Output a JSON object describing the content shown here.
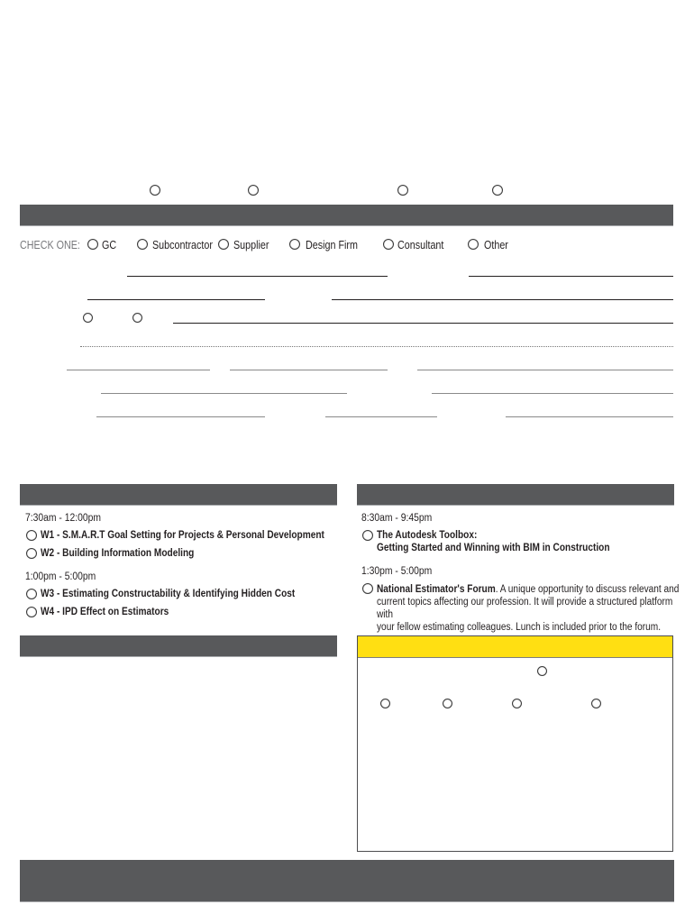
{
  "colors": {
    "header_bar": "#58595b",
    "highlight_header": "#ffdf12",
    "text": "#231f20",
    "muted_text": "#77787b"
  },
  "top_radios": [
    {
      "name": "top-option-1",
      "selected": false
    },
    {
      "name": "top-option-2",
      "selected": false
    },
    {
      "name": "top-option-3",
      "selected": false
    },
    {
      "name": "top-option-4",
      "selected": false
    }
  ],
  "company_type": {
    "label": "CHECK ONE:",
    "options": [
      {
        "label": "GC",
        "selected": false
      },
      {
        "label": "Subcontractor",
        "selected": false
      },
      {
        "label": "Supplier",
        "selected": false
      },
      {
        "label": "Design Firm",
        "selected": false
      },
      {
        "label": "Consultant",
        "selected": false
      },
      {
        "label": "Other",
        "selected": false
      }
    ]
  },
  "inline_radios": [
    {
      "name": "inline-option-1",
      "selected": false
    },
    {
      "name": "inline-option-2",
      "selected": false
    }
  ],
  "workshops": {
    "morning_time": "7:30am - 12:00pm",
    "afternoon_time": "1:00pm - 5:00pm",
    "items": [
      {
        "label": "W1 - S.M.A.R.T Goal Setting for Projects & Personal Development",
        "selected": false
      },
      {
        "label": "W2 - Building Information Modeling",
        "selected": false
      },
      {
        "label": "W3 - Estimating Constructability & Identifying Hidden Cost",
        "selected": false
      },
      {
        "label": "W4 - IPD Effect on Estimators",
        "selected": false
      }
    ]
  },
  "sessions": {
    "morning_time": "8:30am - 9:45pm",
    "afternoon_time": "1:30pm - 5:00pm",
    "autodesk": {
      "line1": "The Autodesk Toolbox:",
      "line2": "Getting Started and Winning with BIM in Construction",
      "selected": false
    },
    "forum": {
      "title": "National Estimator's Forum",
      "description_line1": ". A unique opportunity to discuss relevant and",
      "description_line2": "current topics affecting our profession. It will provide a structured platform with",
      "description_line3": "your fellow estimating colleagues. Lunch is included prior to the forum.",
      "selected": false
    }
  },
  "payment_box": {
    "radios_row1": [
      {
        "name": "payment-option-top",
        "selected": false
      }
    ],
    "radios_row2": [
      {
        "name": "payment-option-1",
        "selected": false
      },
      {
        "name": "payment-option-2",
        "selected": false
      },
      {
        "name": "payment-option-3",
        "selected": false
      },
      {
        "name": "payment-option-4",
        "selected": false
      }
    ]
  }
}
